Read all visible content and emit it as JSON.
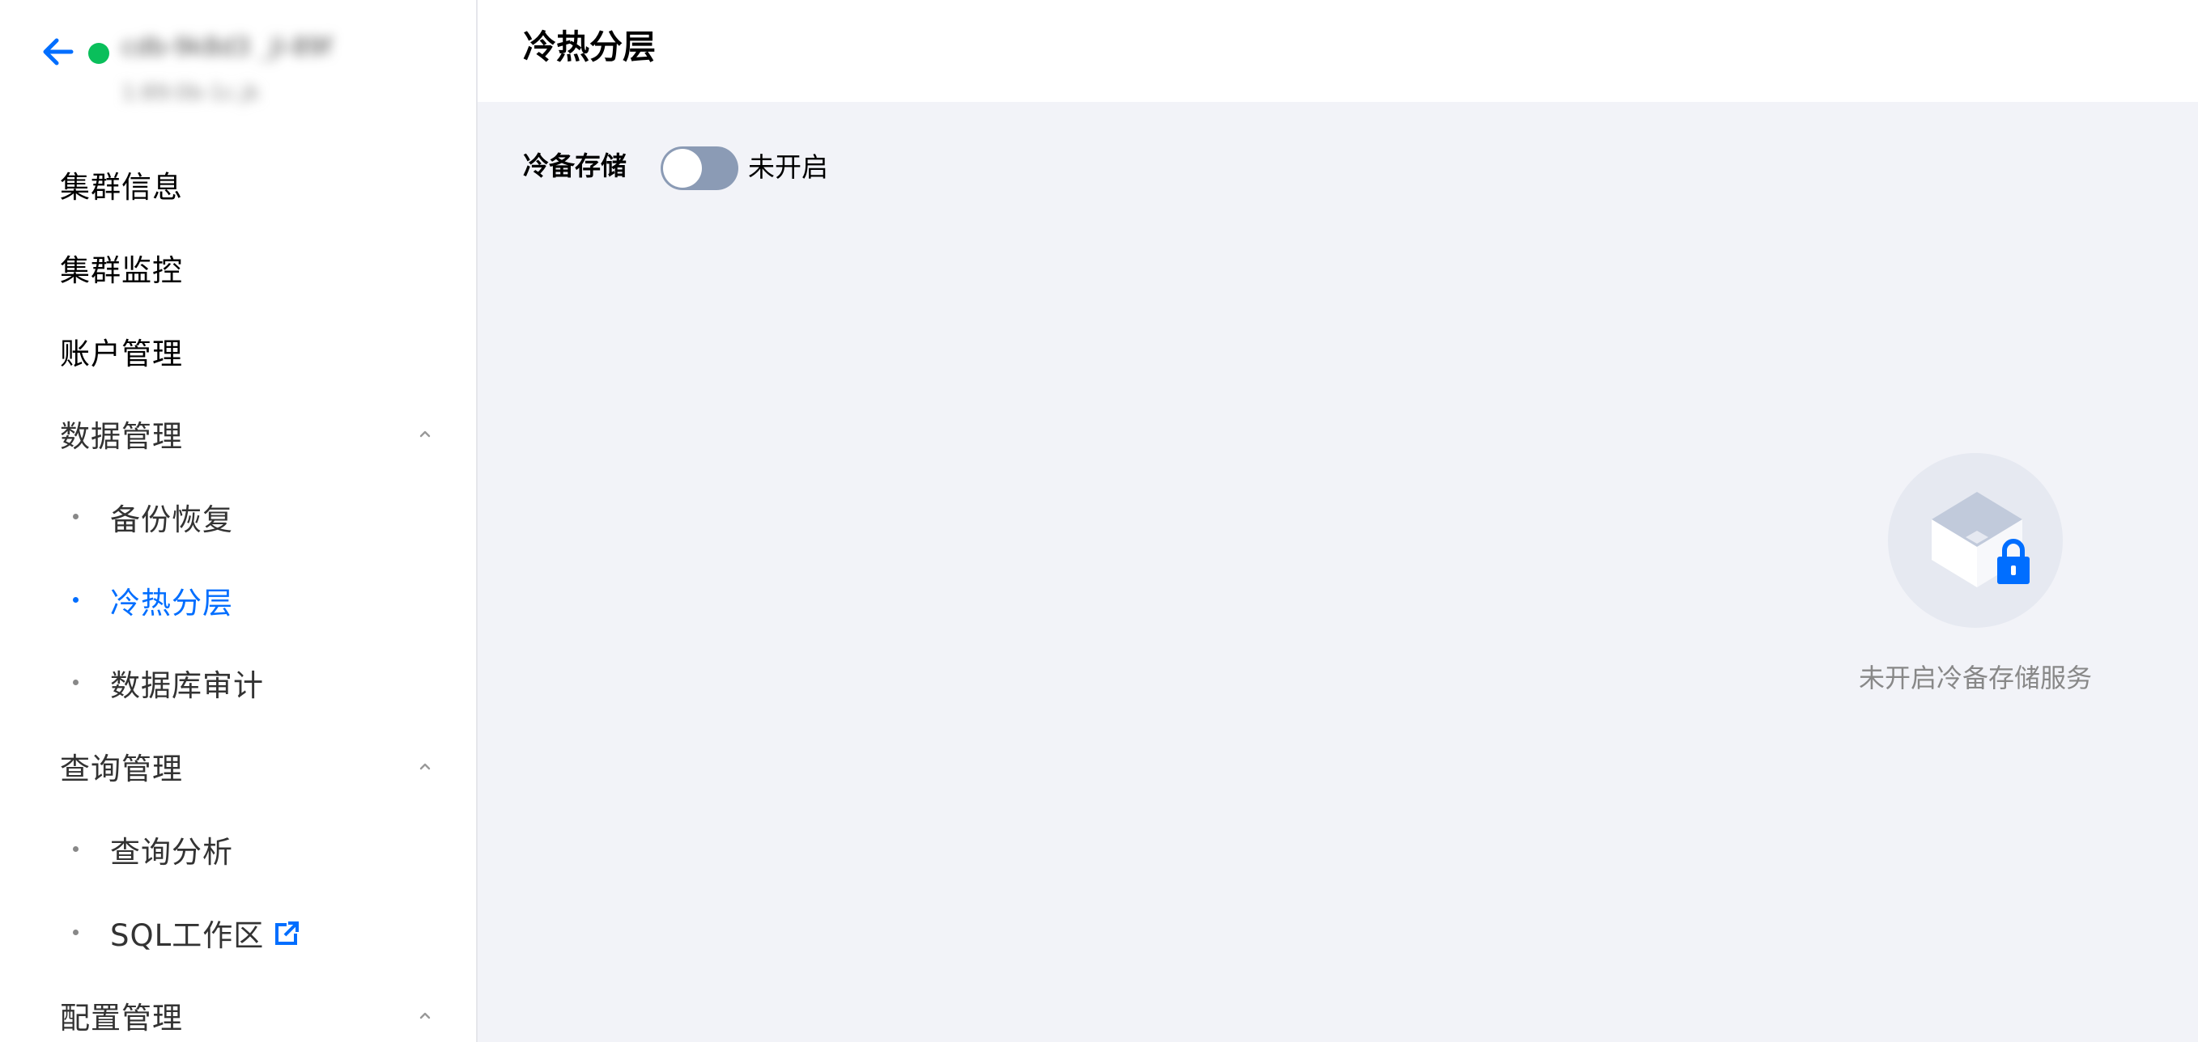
{
  "sidebar": {
    "cluster_name": "cdb-9k8d3 _jl-89f",
    "cluster_sub": "1:89:0b-1c.jk",
    "status_color": "#0abf5b",
    "items": [
      {
        "label": "集群信息",
        "type": "top"
      },
      {
        "label": "集群监控",
        "type": "top"
      },
      {
        "label": "账户管理",
        "type": "top"
      },
      {
        "label": "数据管理",
        "type": "group",
        "expanded": true
      },
      {
        "label": "备份恢复",
        "type": "sub"
      },
      {
        "label": "冷热分层",
        "type": "sub",
        "active": true
      },
      {
        "label": "数据库审计",
        "type": "sub"
      },
      {
        "label": "查询管理",
        "type": "group",
        "expanded": true
      },
      {
        "label": "查询分析",
        "type": "sub"
      },
      {
        "label": "SQL工作区",
        "type": "sub",
        "icon": "external-link-icon"
      },
      {
        "label": "配置管理",
        "type": "group",
        "expanded": true
      }
    ]
  },
  "header": {
    "title": "冷热分层"
  },
  "main": {
    "cold_storage_label": "冷备存储",
    "switch_state_text": "未开启",
    "switch_on": false,
    "empty_text": "未开启冷备存储服务"
  },
  "colors": {
    "accent": "#006eff",
    "switch_off": "#8b9bb5",
    "background": "#f2f3f8"
  }
}
